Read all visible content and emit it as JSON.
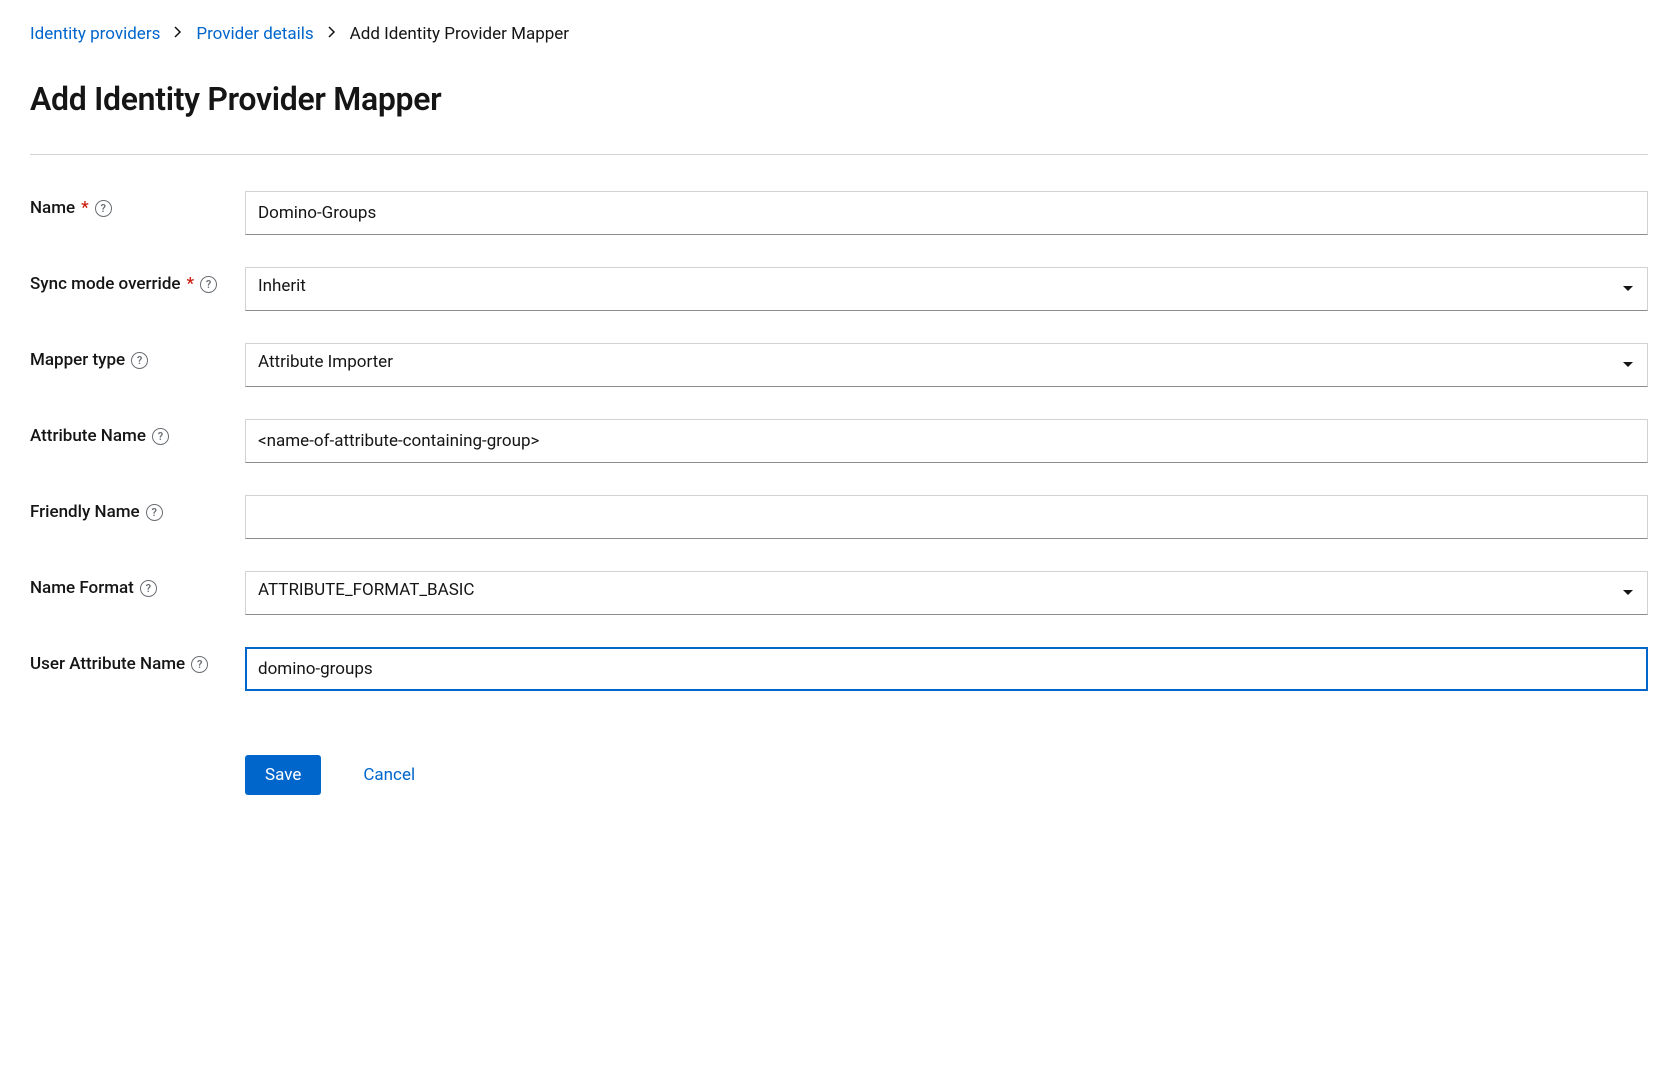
{
  "breadcrumb": {
    "items": [
      {
        "label": "Identity providers",
        "link": true
      },
      {
        "label": "Provider details",
        "link": true
      },
      {
        "label": "Add Identity Provider Mapper",
        "link": false
      }
    ]
  },
  "page": {
    "title": "Add Identity Provider Mapper"
  },
  "fields": {
    "name": {
      "label": "Name",
      "required": true,
      "help": true,
      "value": "Domino-Groups"
    },
    "sync_mode_override": {
      "label": "Sync mode override",
      "required": true,
      "help": true,
      "type": "select",
      "value": "Inherit"
    },
    "mapper_type": {
      "label": "Mapper type",
      "required": false,
      "help": true,
      "type": "select",
      "value": "Attribute Importer"
    },
    "attribute_name": {
      "label": "Attribute Name",
      "required": false,
      "help": true,
      "value": "<name-of-attribute-containing-group>"
    },
    "friendly_name": {
      "label": "Friendly Name",
      "required": false,
      "help": true,
      "value": ""
    },
    "name_format": {
      "label": "Name Format",
      "required": false,
      "help": true,
      "type": "select",
      "value": "ATTRIBUTE_FORMAT_BASIC"
    },
    "user_attr_name": {
      "label": "User Attribute Name",
      "required": false,
      "help": true,
      "value": "domino-groups",
      "focused": true
    }
  },
  "actions": {
    "save": "Save",
    "cancel": "Cancel"
  }
}
